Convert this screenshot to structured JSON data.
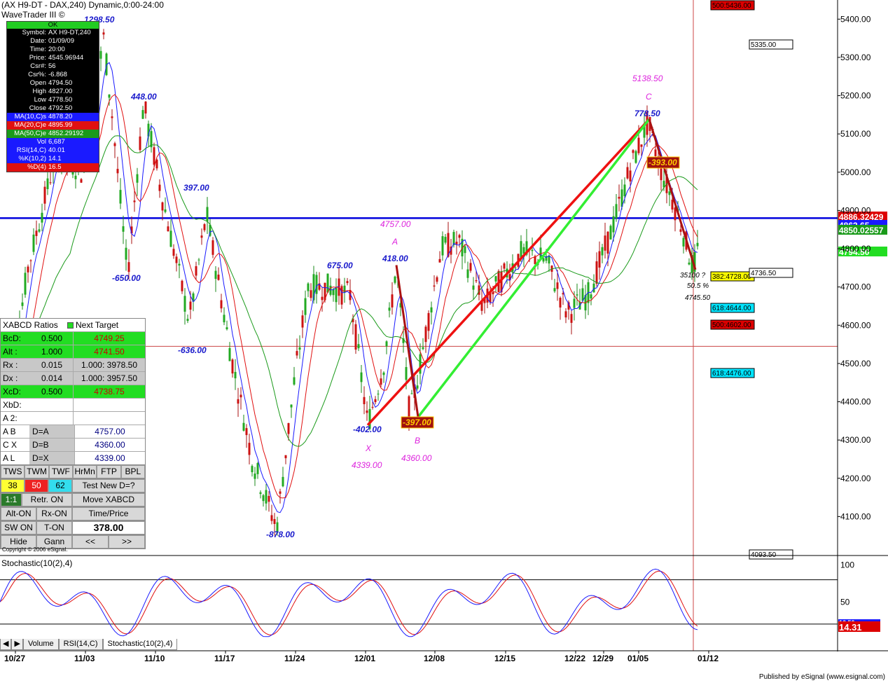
{
  "header": {
    "title": "(AX H9-DT - DAX,240) Dynamic,0:00-24:00",
    "subtitle": "WaveTrader III ©"
  },
  "info_panel": {
    "status": "OK",
    "rows": [
      {
        "k": "Symbol:",
        "v": "AX H9-DT,240",
        "color": "#000000"
      },
      {
        "k": "Date:",
        "v": "01/09/09",
        "color": "#000000"
      },
      {
        "k": "Time:",
        "v": "20:00",
        "color": "#000000"
      },
      {
        "k": "Price:",
        "v": "4545.96944",
        "color": "#000000"
      },
      {
        "k": "Csr#:",
        "v": "56",
        "color": "#000000"
      },
      {
        "k": "Csr%:",
        "v": "-6.868",
        "color": "#000000"
      },
      {
        "k": "Open",
        "v": "4794.50",
        "color": "#000000"
      },
      {
        "k": "High",
        "v": "4827.00",
        "color": "#000000"
      },
      {
        "k": "Low",
        "v": "4778.50",
        "color": "#000000"
      },
      {
        "k": "Close",
        "v": "4792.50",
        "color": "#000000"
      },
      {
        "k": "MA(10,C)s",
        "v": "4878.20",
        "color": "#1a1aff"
      },
      {
        "k": "MA(20,C)e",
        "v": "4895.99",
        "color": "#e01010"
      },
      {
        "k": "MA(50,C)e",
        "v": "4852.29192",
        "color": "#1a9a1a"
      },
      {
        "k": "Vol",
        "v": "6,687",
        "color": "#1a1aff"
      },
      {
        "k": "RSI(14,C)",
        "v": "40.01",
        "color": "#1a1aff"
      },
      {
        "k": "%K(10,2)",
        "v": "14.1",
        "color": "#1a1aff"
      },
      {
        "k": "%D(4)",
        "v": "16.5",
        "color": "#e01010"
      }
    ]
  },
  "xabcd_panel": {
    "title": "XABCD Ratios",
    "next_target_label": "Next Target",
    "rows": [
      {
        "label": "BcD:",
        "ratio": "0.500",
        "target": "4749.25",
        "bg": "#22dd22",
        "tcolor": "#cc0000"
      },
      {
        "label": "Alt :",
        "ratio": "1.000",
        "target": "4741.50",
        "bg": "#22dd22",
        "tcolor": "#cc0000"
      },
      {
        "label": "Rx :",
        "ratio": "0.015",
        "target": "1.000: 3978.50",
        "bg": "#c8c8c8",
        "tcolor": "#000000"
      },
      {
        "label": "Dx :",
        "ratio": "0.014",
        "target": "1.000: 3957.50",
        "bg": "#c8c8c8",
        "tcolor": "#000000"
      },
      {
        "label": "XcD:",
        "ratio": "0.500",
        "target": "4738.75",
        "bg": "#22dd22",
        "tcolor": "#cc0000"
      },
      {
        "label": "XbD:",
        "ratio": "",
        "target": "",
        "bg": "#ffffff",
        "tcolor": "#000000"
      },
      {
        "label": "A 2:",
        "ratio": "",
        "target": "",
        "bg": "#ffffff",
        "tcolor": "#000000"
      }
    ],
    "d_rows": [
      {
        "label": "A B",
        "rel": "D=A",
        "value": "4757.00"
      },
      {
        "label": "C X",
        "rel": "D=B",
        "value": "4360.00"
      },
      {
        "label": "A L",
        "rel": "D=X",
        "value": "4339.00"
      }
    ],
    "buttons_row1": [
      "TWS",
      "TWM",
      "TWF",
      "HrMn",
      "FTP",
      "BPL"
    ],
    "wave_counts": [
      "38",
      "50",
      "62"
    ],
    "test_new": "Test New D=?",
    "ratio_btn": "1:1",
    "retr": "Retr. ON",
    "move": "Move XABCD",
    "alt_on": "Alt-ON",
    "rx_on": "Rx-ON",
    "time_price": "Time/Price",
    "sw_on": "SW ON",
    "t_on": "T-ON",
    "time_price_value": "378.00",
    "hide": "Hide",
    "gann": "Gann",
    "prev": "<<",
    "next": ">>"
  },
  "copyright": "Copyright © 2006 eSignal.",
  "stochastic_title": "Stochastic(10(2),4)",
  "tabs": [
    {
      "label": "Volume",
      "active": false
    },
    {
      "label": "RSI(14,C)",
      "active": false
    },
    {
      "label": "Stochastic(10(2),4)",
      "active": true
    }
  ],
  "credit": "Published by eSignal (www.esignal.com)",
  "chart_data": [
    {
      "type": "candlestick",
      "title": "(AX H9-DT - DAX,240) Dynamic,0:00-24:00",
      "ylim": [
        4000,
        5450
      ],
      "y_ticks": [
        4100,
        4200,
        4300,
        4400,
        4500,
        4600,
        4700,
        4800,
        4900,
        5000,
        5100,
        5200,
        5300,
        5400
      ],
      "y_tick_labels": [
        "4100.00",
        "4200.00",
        "4300.00",
        "4400.00",
        "4500.00",
        "4600.00",
        "4700.00",
        "4800.00",
        "4900.00",
        "5000.00",
        "5100.00",
        "5200.00",
        "5300.00",
        "5400.00"
      ],
      "x_tick_labels": [
        "10/27",
        "11/03",
        "11/10",
        "11/17",
        "11/24",
        "12/01",
        "12/08",
        "12/15",
        "12/22",
        "12/29",
        "01/05",
        "01/12"
      ],
      "last_price": "4794.50",
      "horizontal_lines": [
        {
          "value": 4880,
          "color": "#0000dd"
        },
        {
          "value": 4545,
          "color": "#cc4444"
        }
      ],
      "price_labels_right": [
        {
          "text": "4886.32429",
          "value": 4886,
          "bg": "#dd0000",
          "color": "#ffffff"
        },
        {
          "text": "4863.65",
          "value": 4863,
          "bg": "#1a1aff",
          "color": "#ffffff"
        },
        {
          "text": "4850.02557",
          "value": 4850,
          "bg": "#1a9a1a",
          "color": "#ffffff"
        },
        {
          "text": "4794.50",
          "value": 4794,
          "bg": "#22dd22",
          "color": "#ffffff"
        }
      ],
      "target_boxes": [
        {
          "text": "500:5436.00",
          "bg": "#dd0000",
          "color": "#000000"
        },
        {
          "text": "5335.00",
          "bg": "#ffffff",
          "color": "#000000"
        },
        {
          "text": "382:4728.00",
          "bg": "#ffff00",
          "color": "#000000"
        },
        {
          "text": "4736.50",
          "bg": "#ffffff",
          "color": "#000000"
        },
        {
          "text": "618:4644.00",
          "bg": "#00e5ff",
          "color": "#000000"
        },
        {
          "text": "500:4602.00",
          "bg": "#dd0000",
          "color": "#000000"
        },
        {
          "text": "618:4476.00",
          "bg": "#00e5ff",
          "color": "#000000"
        },
        {
          "text": "4093.50",
          "bg": "#ffffff",
          "color": "#000000"
        }
      ],
      "wave_labels_blue": [
        "1298.50",
        "448.00",
        "397.00",
        "-650.00",
        "-636.00",
        "675.00",
        "-878.00",
        "418.00",
        "-402.00",
        "778.50"
      ],
      "pattern_labels_magenta": [
        "5138.50",
        "C",
        "4757.00",
        "A",
        "X",
        "4339.00",
        "B",
        "4360.00"
      ],
      "pattern_boxes": [
        "-393.00",
        "-397.00"
      ],
      "pattern_misc": [
        "35100 ?",
        "50.5 %",
        "4745.50"
      ],
      "pattern_points": {
        "X": {
          "date": "12/01",
          "price": 4339
        },
        "A": {
          "date": "12/04",
          "price": 4757
        },
        "B": {
          "date": "12/05",
          "price": 4360
        },
        "C": {
          "date": "01/06",
          "price": 5138.5
        },
        "D": {
          "date": "01/09",
          "price": 4745.5
        }
      },
      "series": [
        {
          "name": "MA(10,C)s",
          "color": "#1a1aff"
        },
        {
          "name": "MA(20,C)e",
          "color": "#e01010"
        },
        {
          "name": "MA(50,C)e",
          "color": "#1a9a1a"
        }
      ]
    },
    {
      "type": "line",
      "title": "Stochastic(10(2),4)",
      "ylim": [
        0,
        110
      ],
      "y_tick_labels": [
        "100",
        "50"
      ],
      "levels": [
        80,
        20
      ],
      "last_values": [
        "16.50",
        "14.31"
      ],
      "series": [
        {
          "name": "%K(10,2)",
          "color": "#1a1aff"
        },
        {
          "name": "%D(4)",
          "color": "#e01010"
        }
      ]
    }
  ]
}
